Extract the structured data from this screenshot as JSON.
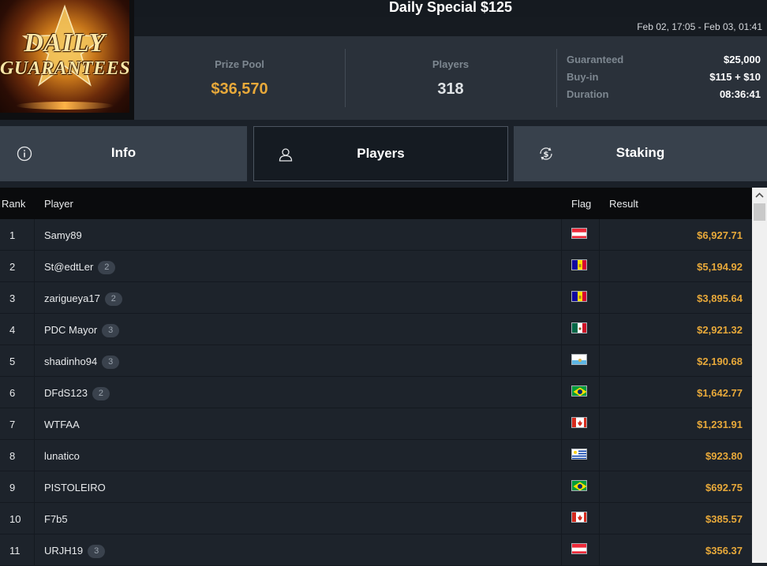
{
  "logo": {
    "line1": "DAILY",
    "line2": "GUARANTEES"
  },
  "tournament": {
    "title": "Daily Special $125",
    "dates": "Feb 02, 17:05 - Feb 03, 01:41"
  },
  "stats": {
    "prize_pool_label": "Prize Pool",
    "prize_pool_value": "$36,570",
    "players_label": "Players",
    "players_value": "318"
  },
  "details": [
    {
      "label": "Guaranteed",
      "value": "$25,000"
    },
    {
      "label": "Buy-in",
      "value": "$115 + $10"
    },
    {
      "label": "Duration",
      "value": "08:36:41"
    }
  ],
  "tabs": [
    {
      "label": "Info",
      "icon": "info-icon",
      "active": false
    },
    {
      "label": "Players",
      "icon": "user-icon",
      "active": true
    },
    {
      "label": "Staking",
      "icon": "dollar-cycle-icon",
      "active": false
    }
  ],
  "table": {
    "headers": {
      "rank": "Rank",
      "player": "Player",
      "flag": "Flag",
      "result": "Result"
    },
    "rows": [
      {
        "rank": "1",
        "player": "Samy89",
        "badge": "",
        "flag": "austria",
        "result": "$6,927.71"
      },
      {
        "rank": "2",
        "player": "St@edtLer",
        "badge": "2",
        "flag": "andorra",
        "result": "$5,194.92"
      },
      {
        "rank": "3",
        "player": "zarigueya17",
        "badge": "2",
        "flag": "andorra",
        "result": "$3,895.64"
      },
      {
        "rank": "4",
        "player": "PDC Mayor",
        "badge": "3",
        "flag": "mexico",
        "result": "$2,921.32"
      },
      {
        "rank": "5",
        "player": "shadinho94",
        "badge": "3",
        "flag": "san-marino",
        "result": "$2,190.68"
      },
      {
        "rank": "6",
        "player": "DFdS123",
        "badge": "2",
        "flag": "brazil",
        "result": "$1,642.77"
      },
      {
        "rank": "7",
        "player": "WTFAA",
        "badge": "",
        "flag": "canada",
        "result": "$1,231.91"
      },
      {
        "rank": "8",
        "player": "lunatico",
        "badge": "",
        "flag": "uruguay",
        "result": "$923.80"
      },
      {
        "rank": "9",
        "player": "PISTOLEIRO",
        "badge": "",
        "flag": "brazil",
        "result": "$692.75"
      },
      {
        "rank": "10",
        "player": "F7b5",
        "badge": "",
        "flag": "canada",
        "result": "$385.57"
      },
      {
        "rank": "11",
        "player": "URJH19",
        "badge": "3",
        "flag": "austria",
        "result": "$356.37"
      }
    ]
  },
  "colors": {
    "accent": "#e8a93a",
    "background": "#1b2129",
    "header": "#2a313a"
  }
}
